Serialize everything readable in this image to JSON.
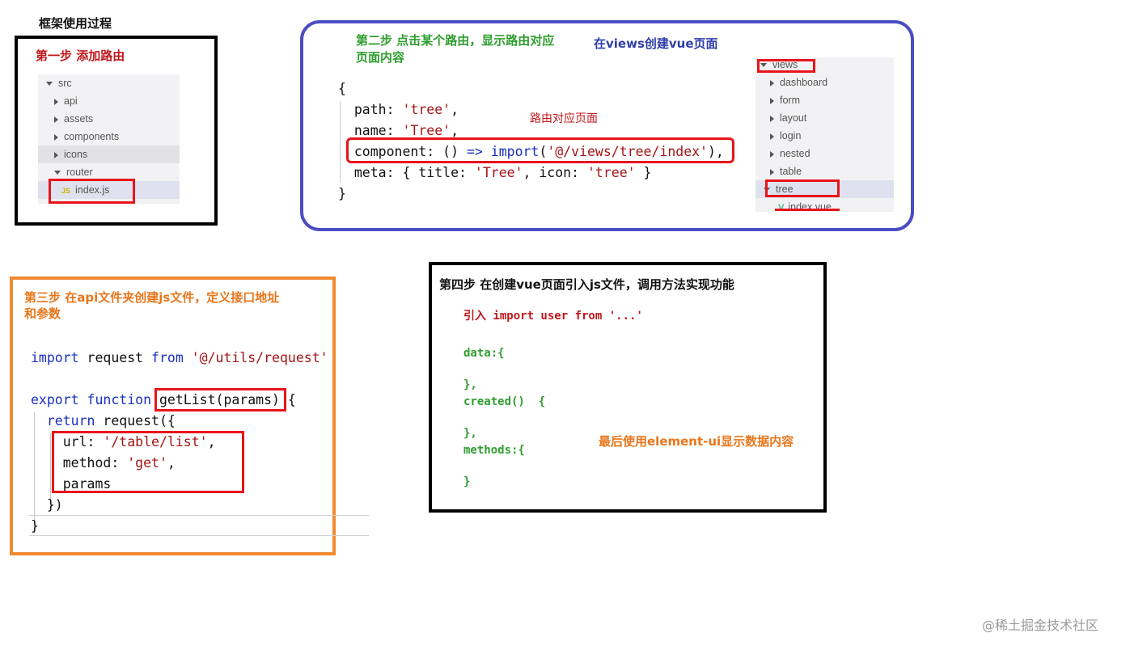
{
  "page_title": "框架使用过程",
  "step1": {
    "title": "第一步  添加路由",
    "tree": [
      {
        "label": "src",
        "arrow": "down",
        "indent": 0
      },
      {
        "label": "api",
        "arrow": "right",
        "indent": 1
      },
      {
        "label": "assets",
        "arrow": "right",
        "indent": 1
      },
      {
        "label": "components",
        "arrow": "right",
        "indent": 1
      },
      {
        "label": "icons",
        "arrow": "right",
        "indent": 1
      },
      {
        "label": "router",
        "arrow": "down",
        "indent": 1
      },
      {
        "label": "index.js",
        "arrow": "none",
        "indent": 2,
        "badge": "JS"
      }
    ]
  },
  "step2": {
    "title": "第二步  点击某个路由，显示路由对应页面内容",
    "views_note": "在views创建vue页面",
    "route_note": "路由对应页面",
    "code": {
      "open": "{",
      "path_key": "  path: ",
      "path_val": "'tree'",
      "name_key": "  name: ",
      "name_val": "'Tree'",
      "comp_key": "  component: () ",
      "comp_arrow": "=>",
      "comp_import": "import",
      "comp_open": "(",
      "comp_val": "'@/views/tree/index'",
      "comp_close": "),",
      "meta_key": "  meta: { title: ",
      "meta_title": "'Tree'",
      "meta_mid": ", icon: ",
      "meta_icon": "'tree'",
      "meta_end": " }",
      "close": "}"
    },
    "tree": [
      {
        "label": "views",
        "arrow": "down",
        "indent": 0
      },
      {
        "label": "dashboard",
        "arrow": "right",
        "indent": 1
      },
      {
        "label": "form",
        "arrow": "right",
        "indent": 1
      },
      {
        "label": "layout",
        "arrow": "right",
        "indent": 1
      },
      {
        "label": "login",
        "arrow": "right",
        "indent": 1
      },
      {
        "label": "nested",
        "arrow": "right",
        "indent": 1
      },
      {
        "label": "table",
        "arrow": "right",
        "indent": 1
      },
      {
        "label": "tree",
        "arrow": "down",
        "indent": 1
      },
      {
        "label": "index.vue",
        "arrow": "none",
        "indent": 2,
        "badge": "V"
      }
    ]
  },
  "step3": {
    "title": "第三步  在api文件夹创建js文件，定义接口地址和参数",
    "code": {
      "import_kw": "import",
      "import_mid": " request ",
      "from_kw": "from",
      "import_path": "'@/utils/request'",
      "export_kw": "export",
      "function_kw": "function",
      "fn_sig": "getList(params)",
      "fn_open": "{",
      "return_kw": "return",
      "return_rest": " request({",
      "url_key": "url: ",
      "url_val": "'/table/list'",
      "url_end": ",",
      "method_key": "method: ",
      "method_val": "'get'",
      "method_end": ",",
      "params": "params",
      "close_call": "})",
      "close_fn": "}"
    }
  },
  "step4": {
    "title": "第四步  在创建vue页面引入js文件，调用方法实现功能",
    "import_line": "引入 import user from '...'",
    "data_open": "data:{",
    "data_close": "},",
    "created_open": "created()  {",
    "created_close": "},",
    "methods_open": "methods:{",
    "methods_close": "}",
    "final_note": "最后使用element-ui显示数据内容"
  },
  "watermark": "@稀土掘金技术社区",
  "colors": {
    "step1_border": "#000000",
    "step2_border": "#4a4ec2",
    "step3_border": "#f08a30",
    "step4_border": "#000000",
    "highlight_box": "#e8141a"
  }
}
